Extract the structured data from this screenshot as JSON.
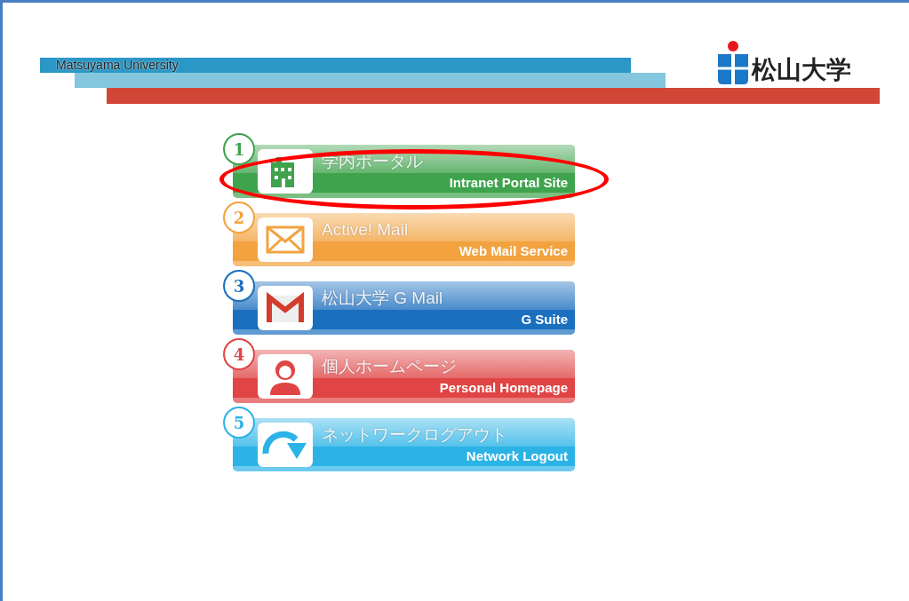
{
  "header": {
    "university_en": "Matsuyama University",
    "logo_text": "松山大学"
  },
  "links": [
    {
      "number": "1",
      "title": "学内ポータル",
      "subtitle": "Intranet Portal Site",
      "color": "#3fa34d",
      "circled": true
    },
    {
      "number": "2",
      "title": "Active! Mail",
      "subtitle": "Web Mail Service",
      "color": "#f2a340",
      "circled": false
    },
    {
      "number": "3",
      "title": "松山大学 G Mail",
      "subtitle": "G Suite",
      "color": "#1b6fbf",
      "circled": false
    },
    {
      "number": "4",
      "title": "個人ホームページ",
      "subtitle": "Personal Homepage",
      "color": "#e04444",
      "circled": false
    },
    {
      "number": "5",
      "title": "ネットワークログアウト",
      "subtitle": "Network Logout",
      "color": "#2bb3e6",
      "circled": false
    }
  ]
}
